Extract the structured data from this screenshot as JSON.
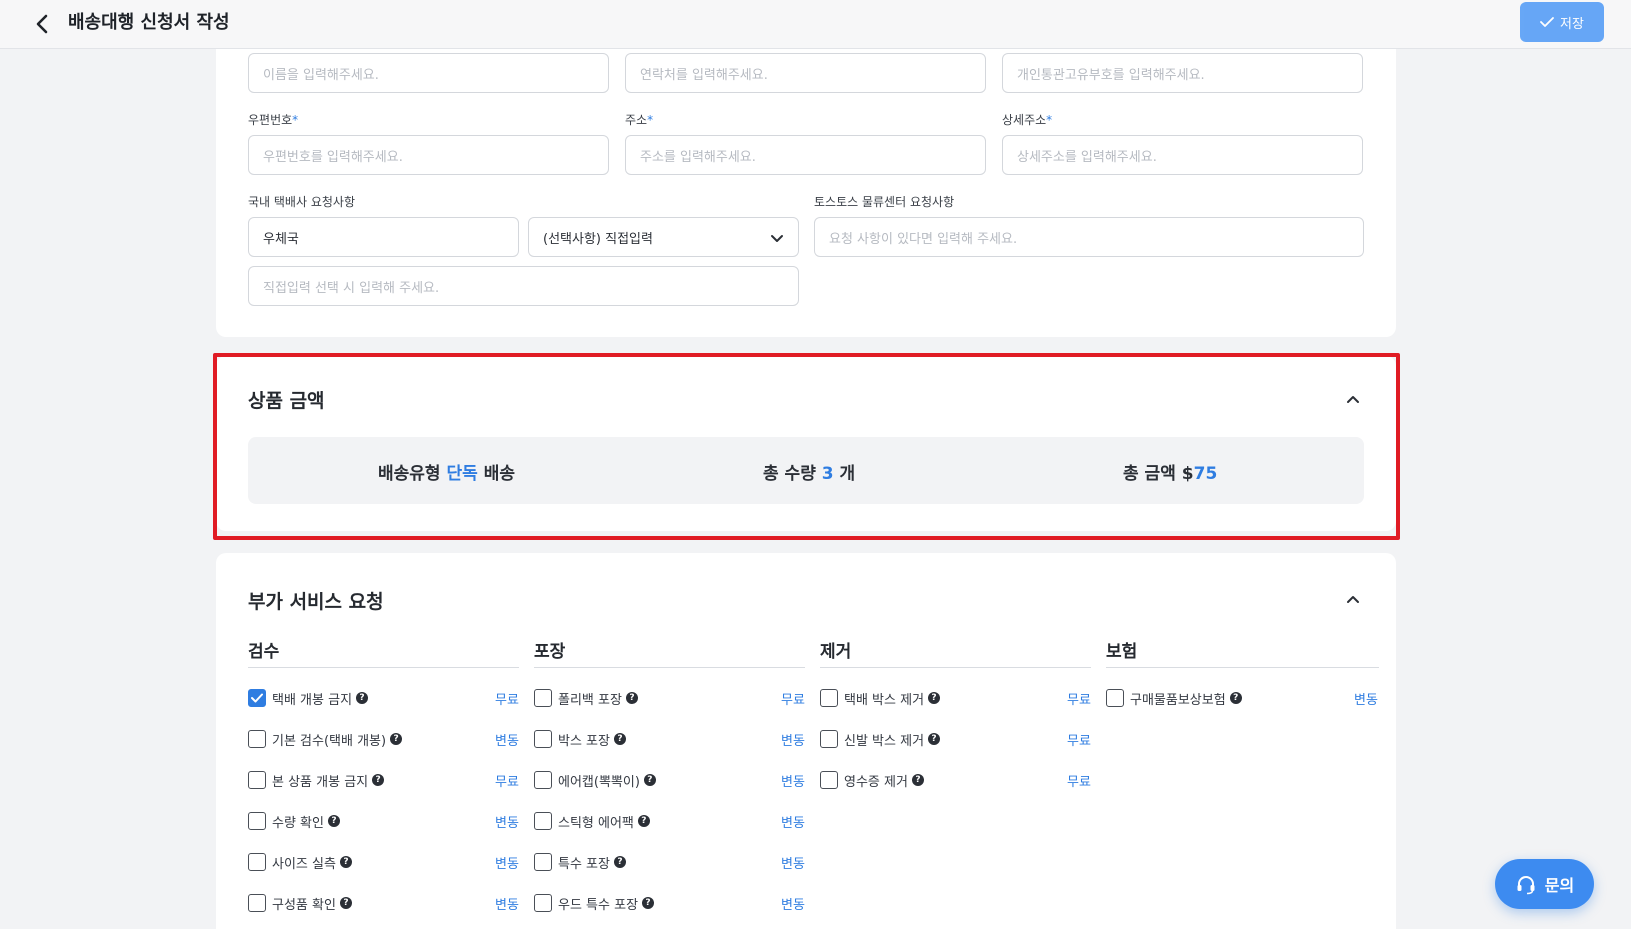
{
  "header": {
    "title": "배송대행 신청서 작성",
    "save_label": "저장"
  },
  "recipient": {
    "name_placeholder": "이름을 입력해주세요.",
    "phone_placeholder": "연락처를 입력해주세요.",
    "customs_placeholder": "개인통관고유부호를 입력해주세요.",
    "zip_label": "우편번호",
    "zip_placeholder": "우편번호를 입력해주세요.",
    "address_label": "주소",
    "address_placeholder": "주소를 입력해주세요.",
    "detail_label": "상세주소",
    "detail_placeholder": "상세주소를 입력해주세요.",
    "required_mark": "*",
    "courier_label": "국내 택배사 요청사항",
    "courier_value": "우체국",
    "courier_request_value": "(선택사항) 직접입력",
    "direct_input_placeholder": "직접입력 선택 시 입력해 주세요.",
    "center_label": "토스토스 물류센터 요청사항",
    "center_placeholder": "요청 사항이 있다면 입력해 주세요."
  },
  "price_section": {
    "title": "상품 금액",
    "shipping_type_label": "배송유형",
    "shipping_type_value": "단독",
    "shipping_type_suffix": "배송",
    "quantity_label": "총 수량",
    "quantity_value": "3",
    "quantity_unit": "개",
    "amount_label": "총 금액",
    "amount_currency": "$",
    "amount_value": "75"
  },
  "services": {
    "title": "부가 서비스 요청",
    "categories": [
      {
        "name": "검수",
        "options": [
          {
            "label": "택배 개봉 금지",
            "price": "무료",
            "checked": true
          },
          {
            "label": "기본 검수(택배 개봉)",
            "price": "변동",
            "checked": false
          },
          {
            "label": "본 상품 개봉 금지",
            "price": "무료",
            "checked": false
          },
          {
            "label": "수량 확인",
            "price": "변동",
            "checked": false
          },
          {
            "label": "사이즈 실측",
            "price": "변동",
            "checked": false
          },
          {
            "label": "구성품 확인",
            "price": "변동",
            "checked": false
          }
        ]
      },
      {
        "name": "포장",
        "options": [
          {
            "label": "폴리백 포장",
            "price": "무료",
            "checked": false
          },
          {
            "label": "박스 포장",
            "price": "변동",
            "checked": false
          },
          {
            "label": "에어캡(뽁뽁이)",
            "price": "변동",
            "checked": false
          },
          {
            "label": "스틱형 에어팩",
            "price": "변동",
            "checked": false
          },
          {
            "label": "특수 포장",
            "price": "변동",
            "checked": false
          },
          {
            "label": "우드 특수 포장",
            "price": "변동",
            "checked": false
          }
        ]
      },
      {
        "name": "제거",
        "options": [
          {
            "label": "택배 박스 제거",
            "price": "무료",
            "checked": false
          },
          {
            "label": "신발 박스 제거",
            "price": "무료",
            "checked": false
          },
          {
            "label": "영수증 제거",
            "price": "무료",
            "checked": false
          }
        ]
      },
      {
        "name": "보험",
        "options": [
          {
            "label": "구매물품보상보험",
            "price": "변동",
            "checked": false
          }
        ]
      }
    ]
  },
  "help_glyph": "?",
  "fab": {
    "label": "문의"
  },
  "colors": {
    "accent": "#2f7de1",
    "highlight_border": "#e01b24"
  }
}
